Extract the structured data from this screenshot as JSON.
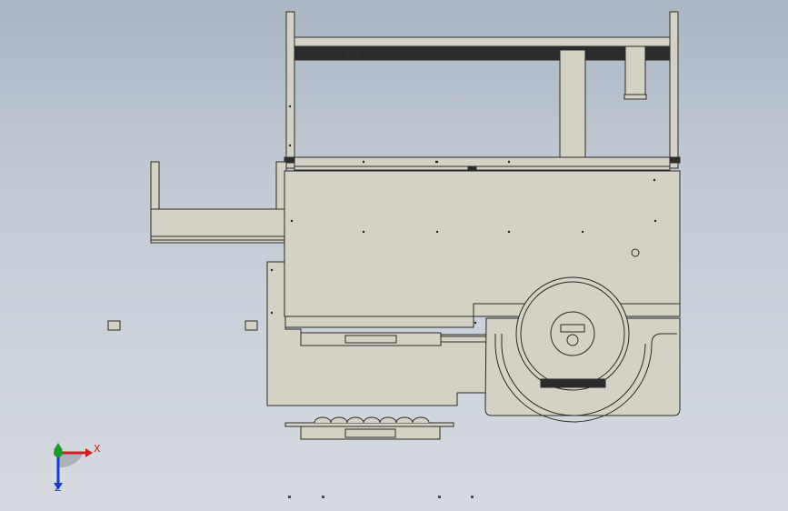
{
  "view": {
    "background_top": "#aab6c4",
    "background_bottom": "#d7dbe1",
    "part_fill": "#d4d2c4",
    "part_stroke": "#2a2a2a",
    "dark_fill": "#2c2c2c"
  },
  "triad": {
    "x_label": "X",
    "z_label": "Z",
    "x_color": "#d21e1e",
    "y_color": "#1a9a2a",
    "z_color": "#1e3cc8"
  }
}
